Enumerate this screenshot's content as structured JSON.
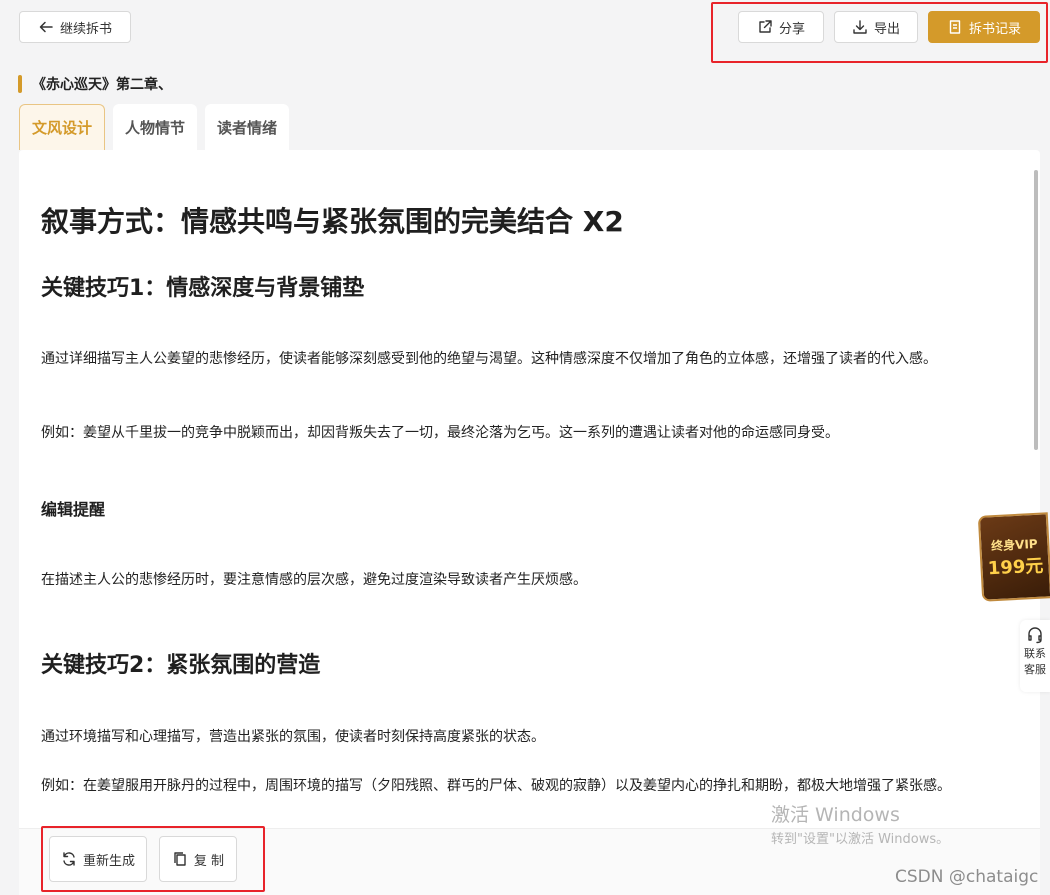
{
  "topbar": {
    "back_label": "继续拆书",
    "share_label": "分享",
    "export_label": "导出",
    "record_label": "拆书记录"
  },
  "chapter": {
    "title": "《赤心巡天》第二章、"
  },
  "tabs": [
    {
      "label": "文风设计",
      "active": true
    },
    {
      "label": "人物情节",
      "active": false
    },
    {
      "label": "读者情绪",
      "active": false
    }
  ],
  "article": {
    "heading": "叙事方式：情感共鸣与紧张氛围的完美结合 X2",
    "section1_title": "关键技巧1：情感深度与背景铺垫",
    "section1_p1": "通过详细描写主人公姜望的悲惨经历，使读者能够深刻感受到他的绝望与渴望。这种情感深度不仅增加了角色的立体感，还增强了读者的代入感。",
    "section1_p2": "例如：姜望从千里拔一的竞争中脱颖而出，却因背叛失去了一切，最终沦落为乞丐。这一系列的遭遇让读者对他的命运感同身受。",
    "editor_title": "编辑提醒",
    "editor_p": "在描述主人公的悲惨经历时，要注意情感的层次感，避免过度渲染导致读者产生厌烦感。",
    "section2_title": "关键技巧2：紧张氛围的营造",
    "section2_p1": "通过环境描写和心理描写，营造出紧张的氛围，使读者时刻保持高度紧张的状态。",
    "section2_p2": "例如：在姜望服用开脉丹的过程中，周围环境的描写（夕阳残照、群丐的尸体、破观的寂静）以及姜望内心的挣扎和期盼，都极大地增强了紧张感。"
  },
  "actions": {
    "regenerate_label": "重新生成",
    "copy_label": "复 制"
  },
  "side": {
    "vip_line1": "终身VIP",
    "vip_line2": "199元",
    "service_line1": "联系",
    "service_line2": "客服"
  },
  "watermark": {
    "activate_title": "激活 Windows",
    "activate_hint": "转到\"设置\"以激活 Windows。",
    "csdn": "CSDN @chataigc"
  },
  "colors": {
    "accent": "#d49a2a",
    "highlight_box": "#e8232a"
  }
}
